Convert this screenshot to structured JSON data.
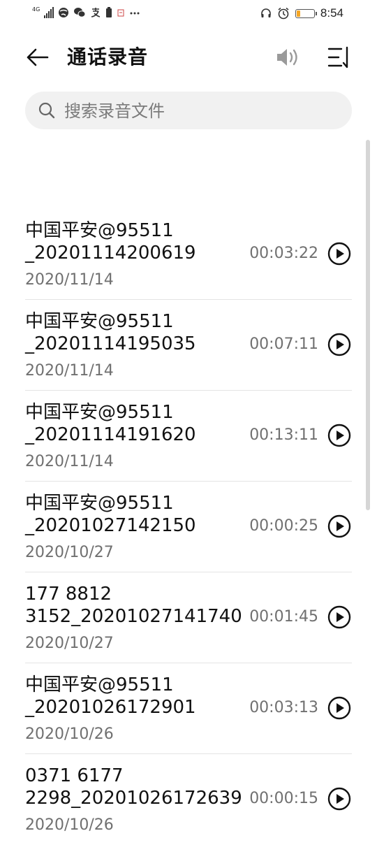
{
  "status_bar": {
    "network": "4G",
    "time": "8:54",
    "battery_level": 0.18
  },
  "app_bar": {
    "title": "通话录音"
  },
  "search": {
    "placeholder": "搜索录音文件",
    "value": ""
  },
  "recordings": [
    {
      "name": "中国平安@95511\n_20201114200619",
      "date": "2020/11/14",
      "duration": "00:03:22"
    },
    {
      "name": "中国平安@95511\n_20201114195035",
      "date": "2020/11/14",
      "duration": "00:07:11"
    },
    {
      "name": "中国平安@95511\n_20201114191620",
      "date": "2020/11/14",
      "duration": "00:13:11"
    },
    {
      "name": "中国平安@95511\n_20201027142150",
      "date": "2020/10/27",
      "duration": "00:00:25"
    },
    {
      "name": "177 8812\n3152_20201027141740",
      "date": "2020/10/27",
      "duration": "00:01:45"
    },
    {
      "name": "中国平安@95511\n_20201026172901",
      "date": "2020/10/26",
      "duration": "00:03:13"
    },
    {
      "name": "0371 6177\n2298_20201026172639",
      "date": "2020/10/26",
      "duration": "00:00:15"
    }
  ],
  "icons": {
    "back": "arrow-left-icon",
    "speaker": "speaker-icon",
    "sort": "sort-icon",
    "search": "search-icon",
    "play": "play-circle-icon"
  },
  "colors": {
    "battery": "#f5a623",
    "secondary_text": "#707070",
    "search_bg": "#f1f1f1"
  }
}
